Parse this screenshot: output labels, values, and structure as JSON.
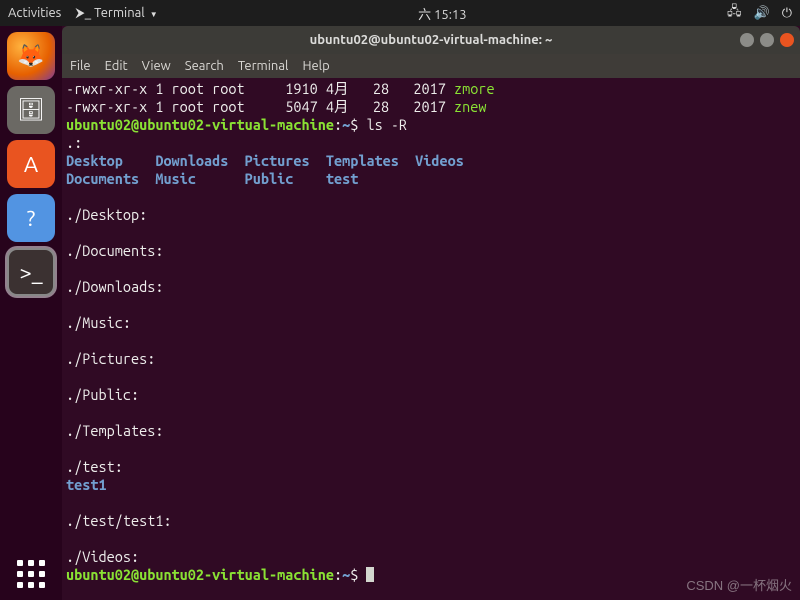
{
  "top_panel": {
    "activities": "Activities",
    "app_indicator": "Terminal",
    "clock": "六 15:13"
  },
  "dock": {
    "items": [
      {
        "name": "firefox"
      },
      {
        "name": "files"
      },
      {
        "name": "software"
      },
      {
        "name": "help"
      },
      {
        "name": "terminal",
        "active": true
      }
    ]
  },
  "window": {
    "title": "ubuntu02@ubuntu02-virtual-machine: ~"
  },
  "menubar": {
    "file": "File",
    "edit": "Edit",
    "view": "View",
    "search": "Search",
    "terminal": "Terminal",
    "help": "Help"
  },
  "terminal": {
    "lines": {
      "perm1a": "-rwxr-xr-x 1 root root     1910 4月   28   2017 ",
      "perm1b": "zmore",
      "perm2a": "-rwxr-xr-x 1 root root     5047 4月   28   2017 ",
      "perm2b": "znew",
      "prompt1_user": "ubuntu02@ubuntu02-virtual-machine",
      "prompt1_colon": ":",
      "prompt1_path": "~",
      "prompt1_dollar": "$",
      "cmd1": " ls -R",
      "dot": ".:",
      "row1": "Desktop    Downloads  Pictures  Templates  Videos",
      "row2": "Documents  Music      Public    test",
      "blank": "",
      "d_desktop": "./Desktop:",
      "d_documents": "./Documents:",
      "d_downloads": "./Downloads:",
      "d_music": "./Music:",
      "d_pictures": "./Pictures:",
      "d_public": "./Public:",
      "d_templates": "./Templates:",
      "d_test": "./test:",
      "test1": "test1",
      "d_test1": "./test/test1:",
      "d_videos": "./Videos:",
      "prompt2_user": "ubuntu02@ubuntu02-virtual-machine",
      "prompt2_colon": ":",
      "prompt2_path": "~",
      "prompt2_dollar": "$ "
    }
  },
  "watermark": "CSDN @一杯烟火"
}
